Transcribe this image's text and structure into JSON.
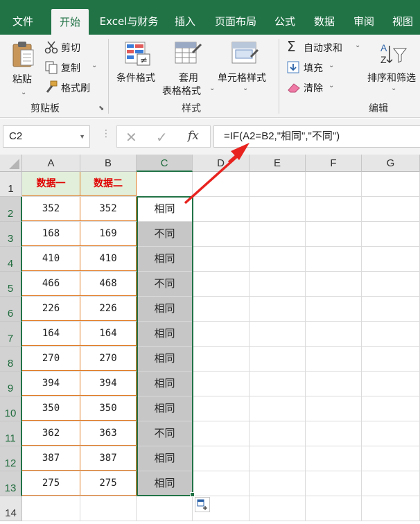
{
  "tabs": [
    "文件",
    "开始",
    "Excel与财务",
    "插入",
    "页面布局",
    "公式",
    "数据",
    "审阅",
    "视图"
  ],
  "active_tab": "开始",
  "ribbon": {
    "clipboard": {
      "paste": "粘贴",
      "cut": "剪切",
      "copy": "复制",
      "format_painter": "格式刷",
      "group_label": "剪贴板"
    },
    "styles": {
      "conditional_format": "条件格式",
      "table_format_line1": "套用",
      "table_format_line2": "表格格式",
      "cell_styles": "单元格样式",
      "group_label": "样式"
    },
    "editing": {
      "autosum": "自动求和",
      "fill": "填充",
      "clear": "清除",
      "sort_filter": "排序和筛选",
      "group_label": "编辑"
    }
  },
  "formula_bar": {
    "name_box": "C2",
    "fx": "fx",
    "formula": "=IF(A2=B2,\"相同\",\"不同\")"
  },
  "columns": [
    "A",
    "B",
    "C",
    "D",
    "E",
    "F",
    "G"
  ],
  "selected_column": "C",
  "headers": {
    "a1": "数据一",
    "b1": "数据二"
  },
  "rows": [
    {
      "row": "2",
      "a": "352",
      "b": "352",
      "c": "相同"
    },
    {
      "row": "3",
      "a": "168",
      "b": "169",
      "c": "不同"
    },
    {
      "row": "4",
      "a": "410",
      "b": "410",
      "c": "相同"
    },
    {
      "row": "5",
      "a": "466",
      "b": "468",
      "c": "不同"
    },
    {
      "row": "6",
      "a": "226",
      "b": "226",
      "c": "相同"
    },
    {
      "row": "7",
      "a": "164",
      "b": "164",
      "c": "相同"
    },
    {
      "row": "8",
      "a": "270",
      "b": "270",
      "c": "相同"
    },
    {
      "row": "9",
      "a": "394",
      "b": "394",
      "c": "相同"
    },
    {
      "row": "10",
      "a": "350",
      "b": "350",
      "c": "相同"
    },
    {
      "row": "11",
      "a": "362",
      "b": "363",
      "c": "不同"
    },
    {
      "row": "12",
      "a": "387",
      "b": "387",
      "c": "相同"
    },
    {
      "row": "13",
      "a": "275",
      "b": "275",
      "c": "相同"
    }
  ],
  "row_numbers": [
    "1",
    "2",
    "3",
    "4",
    "5",
    "6",
    "7",
    "8",
    "9",
    "10",
    "11",
    "12",
    "13",
    "14"
  ],
  "colors": {
    "brand_green": "#217346",
    "header_fill": "#e2efda",
    "header_text": "#e00000",
    "selection_fill": "#c6c6c6",
    "arrow": "#e8231f",
    "table_border": "#e07b25"
  }
}
